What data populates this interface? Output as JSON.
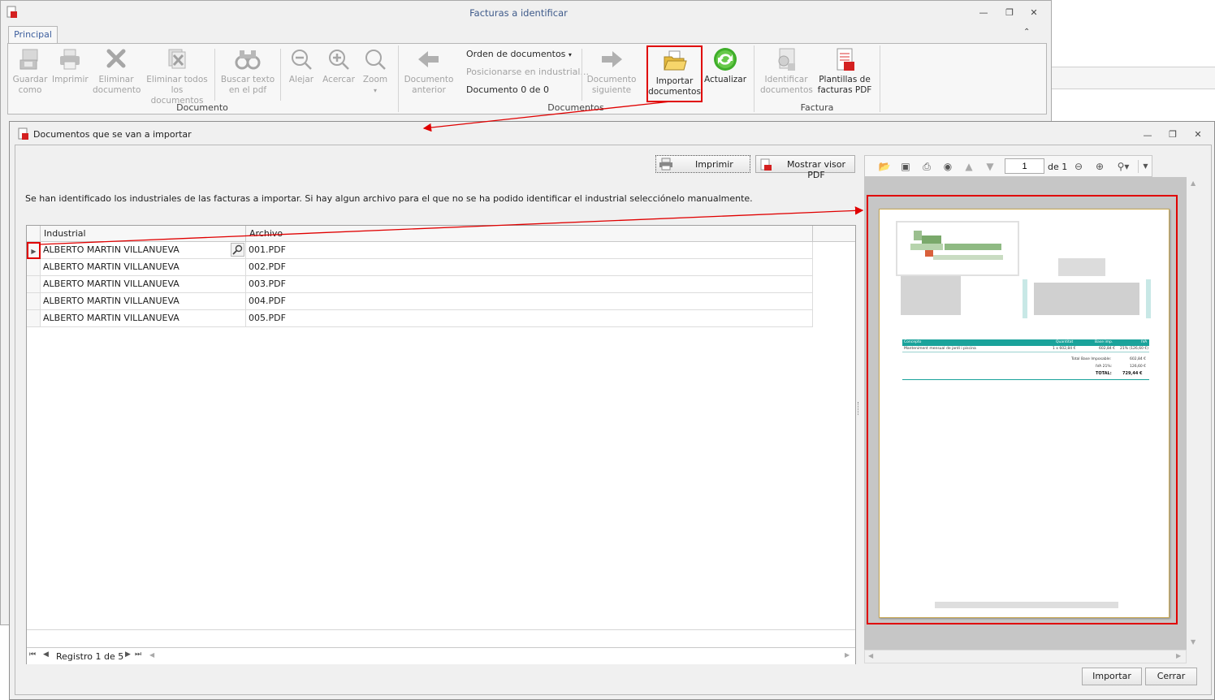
{
  "main_window": {
    "title": "Facturas a identificar",
    "tab": "Principal",
    "ribbon": {
      "guardar_como": [
        "Guardar",
        "como"
      ],
      "imprimir": [
        "Imprimir"
      ],
      "eliminar_documento": [
        "Eliminar",
        "documento"
      ],
      "eliminar_todos": [
        "Eliminar todos",
        "los documentos"
      ],
      "buscar_texto": [
        "Buscar texto",
        "en el pdf"
      ],
      "alejar": [
        "Alejar"
      ],
      "acercar": [
        "Acercar"
      ],
      "zoom": [
        "Zoom"
      ],
      "group_documento": "Documento",
      "documento_anterior": [
        "Documento",
        "anterior"
      ],
      "orden_documentos": "Orden de documentos",
      "posicionarse": "Posicionarse en industrial...",
      "documento_counter": "Documento 0 de 0",
      "documento_siguiente": [
        "Documento",
        "siguiente"
      ],
      "importar_documentos": [
        "Importar",
        "documentos"
      ],
      "actualizar": [
        "Actualizar"
      ],
      "group_documentos": "Documentos",
      "identificar_documentos": [
        "Identificar",
        "documentos"
      ],
      "plantillas": [
        "Plantillas de",
        "facturas PDF"
      ],
      "group_factura": "Factura"
    }
  },
  "dialog": {
    "title": "Documentos que se van a importar",
    "imprimir_label": "Imprimir",
    "mostrar_visor_label": "Mostrar visor PDF",
    "instructions": "Se han identificado los industriales de las facturas a importar. Si hay algun archivo para el que no se ha podido identificar el industrial selecciónelo manualmente.",
    "grid": {
      "columns": [
        "Industrial",
        "Archivo"
      ],
      "rows": [
        {
          "industrial": "ALBERTO MARTIN VILLANUEVA",
          "archivo": "001.PDF"
        },
        {
          "industrial": "ALBERTO MARTIN VILLANUEVA",
          "archivo": "002.PDF"
        },
        {
          "industrial": "ALBERTO MARTIN VILLANUEVA",
          "archivo": "003.PDF"
        },
        {
          "industrial": "ALBERTO MARTIN VILLANUEVA",
          "archivo": "004.PDF"
        },
        {
          "industrial": "ALBERTO MARTIN VILLANUEVA",
          "archivo": "005.PDF"
        }
      ],
      "navigator": "Registro 1 de 5"
    },
    "viewer": {
      "page_input": "1",
      "page_total": "de 1"
    },
    "pdf": {
      "table_headers": [
        "Concepto",
        "Quantitat",
        "Base imp.",
        "IVA"
      ],
      "line_concepto": "Manteniment mensual de jardí i piscina",
      "line_quantitat": "1 x 602,84 €",
      "line_base": "602,84 €",
      "line_iva": "21% (126,60 €)",
      "total_base_label": "Total Base Imposable:",
      "total_base_value": "602,84 €",
      "iva_label": "IVA 21%:",
      "iva_value": "126,60 €",
      "total_label": "TOTAL:",
      "total_value": "729,44 €"
    },
    "importar_label": "Importar",
    "cerrar_label": "Cerrar"
  },
  "colors": {
    "highlight": "#e00000",
    "teal": "#1aa39b",
    "accent_text": "#3e5a8a"
  }
}
